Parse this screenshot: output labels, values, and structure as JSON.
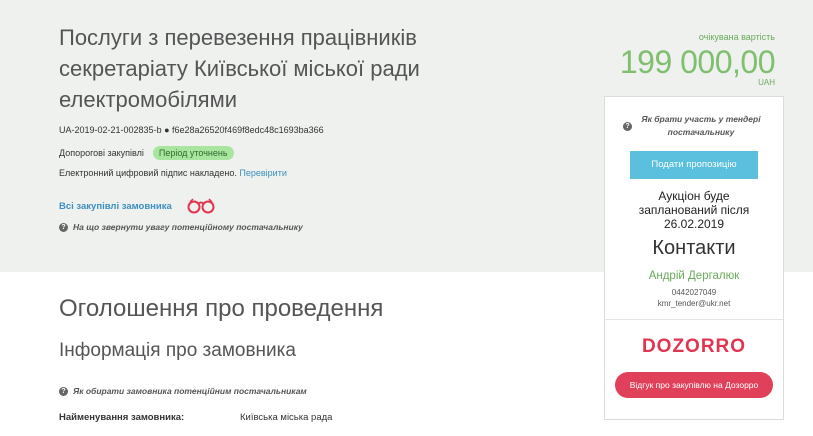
{
  "tender": {
    "title": "Послуги з перевезення працівників секретаріату Київської міської ради електромобілями",
    "id_line": "UA-2019-02-21-002835-b ● f6e28a26520f469f8edc48c1693ba366",
    "procedure_type": "Допорогові закупівлі",
    "status_badge": "Період уточнень",
    "signature_text": "Електронний цифровий підпис накладено.",
    "verify_link": "Перевірити",
    "all_tenders_link": "Всі закупівлі замовника",
    "help_attention": "На що звернути увагу потенційному постачальнику"
  },
  "price": {
    "caption": "очікувана вартість",
    "amount": "199 000,00",
    "currency": "UAH"
  },
  "side_panel": {
    "help_participate": "Як брати участь у тендері постачальнику",
    "submit_button": "Подати пропозицію",
    "auction_text": "Аукціон буде запланований після 26.02.2019",
    "contacts_title": "Контакти",
    "contact_name": "Андрій Дергалюк",
    "contact_phone": "0442027049",
    "contact_email": "kmr_tender@ukr.net",
    "dozorro_logo": "DOZORRO",
    "review_button": "Відгук про закупівлю на Дозорро"
  },
  "announcement": {
    "heading": "Оголошення про проведення",
    "customer_heading": "Інформація про замовника",
    "help_choose": "Як обирати замовника потенційним постачальникам",
    "customer_name_label": "Найменування замовника:",
    "customer_name_value": "Київська міська рада"
  },
  "colors": {
    "band_bg": "#eef1ee",
    "accent_green": "#7fbf6e",
    "link_blue": "#3d8fc4",
    "submit_blue": "#5bc0de",
    "dozorro_red": "#e03550"
  },
  "icons": [
    "help-circle-icon",
    "binoculars-icon"
  ]
}
